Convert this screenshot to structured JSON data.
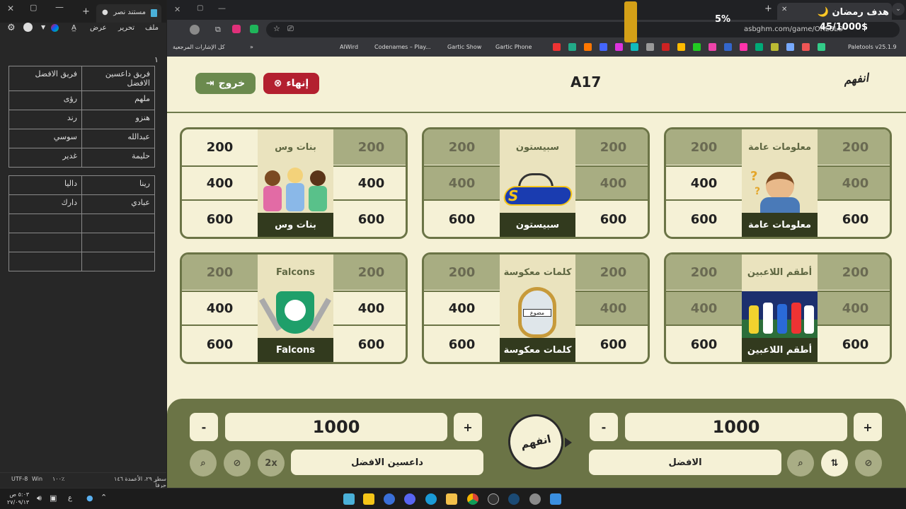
{
  "notepad": {
    "tab_title": "مستند نصر",
    "menu": {
      "file": "ملف",
      "edit": "تحرير",
      "view": "عرض"
    },
    "line_marker": "١",
    "table1": [
      [
        "فريق داعسين الافضل",
        "فريق الافضل"
      ],
      [
        "ملهم",
        "رؤى"
      ],
      [
        "هنزو",
        "رند"
      ],
      [
        "عبدالله",
        "سوسي"
      ],
      [
        "حليمة",
        "غدير"
      ]
    ],
    "table2": [
      [
        "رينا",
        "داليا"
      ],
      [
        "عبادي",
        "دارك"
      ],
      [
        "",
        ""
      ],
      [
        "",
        ""
      ],
      [
        "",
        ""
      ]
    ],
    "status": {
      "position": "سطر ٢٩، الأعمدة ١٤٦ حرفاً",
      "zoom": "١٠٠٪",
      "eol": "Win",
      "encoding": "UTF-8"
    }
  },
  "browser": {
    "url": "asbghm.com/game/ORE8LO",
    "bookmarks": [
      "AIWird",
      "Codenames – Play...",
      "Gartic Show",
      "Gartic Phone",
      "كل الإشارات المرجعية",
      "Paletools v25.1.9"
    ]
  },
  "overlay": {
    "title": "هدف رمضان 🌙",
    "progress": "45/1000$",
    "percent": "5%"
  },
  "game": {
    "room_code": "A17",
    "logo": "انفهم",
    "exit_label": "خروج",
    "end_label": "إنهاء",
    "categories": [
      {
        "name": "معلومات عامة",
        "top": "معلومات عامة"
      },
      {
        "name": "سبيستون",
        "top": "سبيستون"
      },
      {
        "name": "بنات وس",
        "top": "بنات وس"
      },
      {
        "name": "أطقم اللاعبين",
        "top": "أطقم اللاعبين"
      },
      {
        "name": "كلمات معكوسة",
        "top": "كلمات معكوسة"
      },
      {
        "name": "Falcons",
        "top": "Falcons"
      }
    ],
    "points": [
      "200",
      "400",
      "600"
    ],
    "mirror_label": "مضوع",
    "team_right": {
      "name": "الافضل",
      "score": "1000"
    },
    "team_left": {
      "name": "داعسين الافضل",
      "score": "1000"
    },
    "minus": "-",
    "plus": "+",
    "double": "2x",
    "center_logo": "انفهم"
  },
  "taskbar": {
    "time": "٥:٠٣ ص",
    "date": "٢٧/٠٩/١٣",
    "lang": "ع"
  },
  "colors": {
    "olive": "#6b7446",
    "cream": "#f5f1d6",
    "red": "#b3202f",
    "green": "#6b8a4e"
  }
}
